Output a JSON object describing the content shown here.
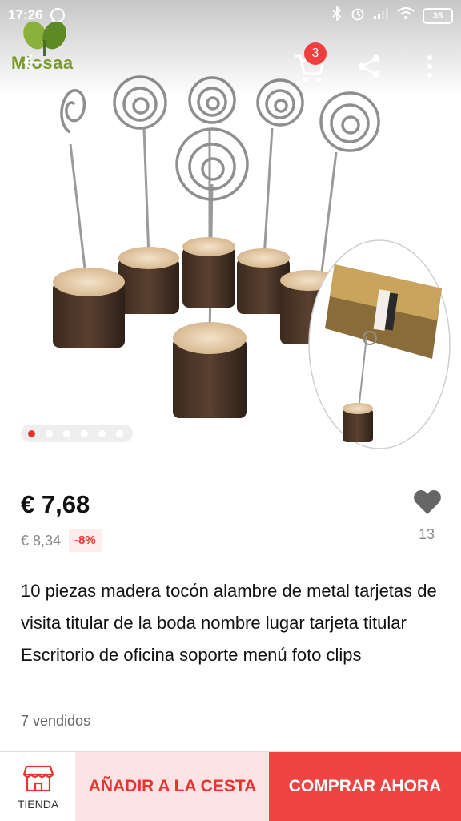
{
  "status_bar": {
    "time": "17:26",
    "battery": "35"
  },
  "header": {
    "logo_text": "Miosaa",
    "cart_count": "3"
  },
  "gallery": {
    "total_images": 6,
    "active_index": 0
  },
  "product": {
    "price": "€ 7,68",
    "old_price": "€ 8,34",
    "discount": "-8%",
    "wishlist_count": "13",
    "title": "10 piezas madera tocón alambre de metal tarjetas de visita titular de la boda nombre lugar tarjeta titular Escritorio de oficina soporte menú foto clips",
    "sold": "7 vendidos"
  },
  "actions": {
    "store_label": "TIENDA",
    "add_to_cart_label": "AÑADIR A LA CESTA",
    "buy_now_label": "COMPRAR AHORA"
  },
  "colors": {
    "accent_red": "#f04444",
    "accent_light_red": "#fde3e3",
    "logo_green": "#7a9a2d"
  },
  "icons": [
    "back-arrow-icon",
    "cart-icon",
    "share-icon",
    "more-vert-icon",
    "heart-icon",
    "store-icon",
    "whatsapp-icon",
    "bluetooth-icon",
    "alarm-icon",
    "signal-icon",
    "wifi-icon",
    "battery-icon"
  ]
}
